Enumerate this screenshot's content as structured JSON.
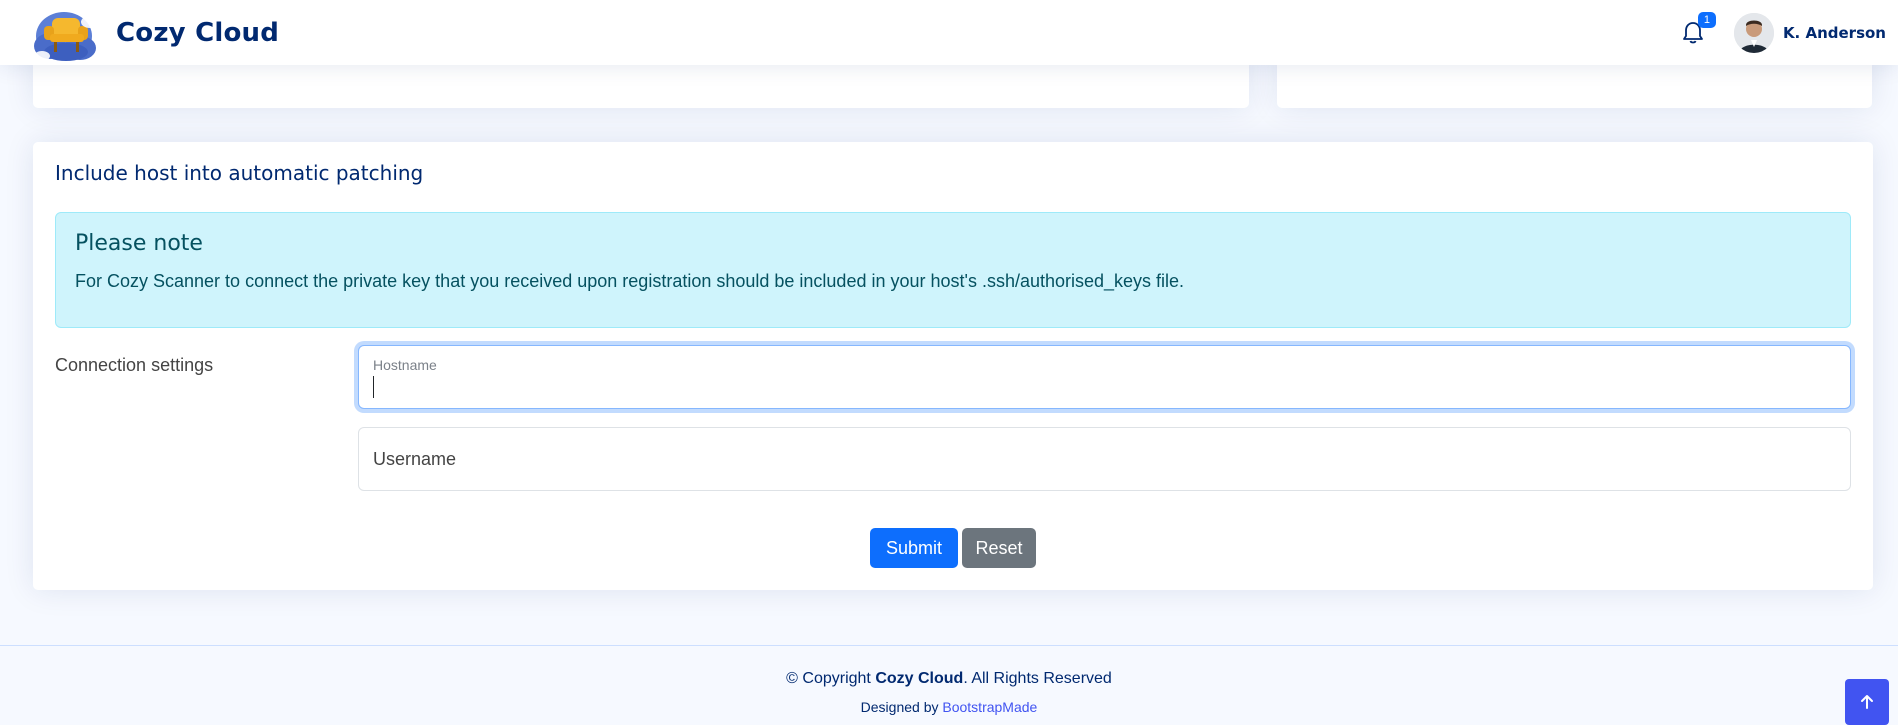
{
  "header": {
    "brand": "Cozy Cloud",
    "notifications_count": "1",
    "user_name": "K. Anderson"
  },
  "form_card": {
    "title": "Include host into automatic patching",
    "alert": {
      "heading": "Please note",
      "text": "For Cozy Scanner to connect the private key that you received upon registration should be included in your host's .ssh/authorised_keys file."
    },
    "connection_label": "Connection settings",
    "hostname": {
      "label": "Hostname",
      "value": ""
    },
    "username": {
      "placeholder": "Username",
      "value": ""
    },
    "submit_label": "Submit",
    "reset_label": "Reset"
  },
  "footer": {
    "copyright_prefix": "© Copyright ",
    "copyright_brand": "Cozy Cloud",
    "copyright_suffix": ". All Rights Reserved",
    "designed_by_prefix": "Designed by ",
    "designed_by_link": "BootstrapMade"
  },
  "colors": {
    "brand": "#012970",
    "primary": "#0d6efd",
    "secondary": "#6c757d",
    "alert_bg": "#cff4fc",
    "back_to_top": "#4154f1"
  },
  "icons": {
    "bell": "bell-icon",
    "back_to_top": "arrow-up-icon"
  }
}
